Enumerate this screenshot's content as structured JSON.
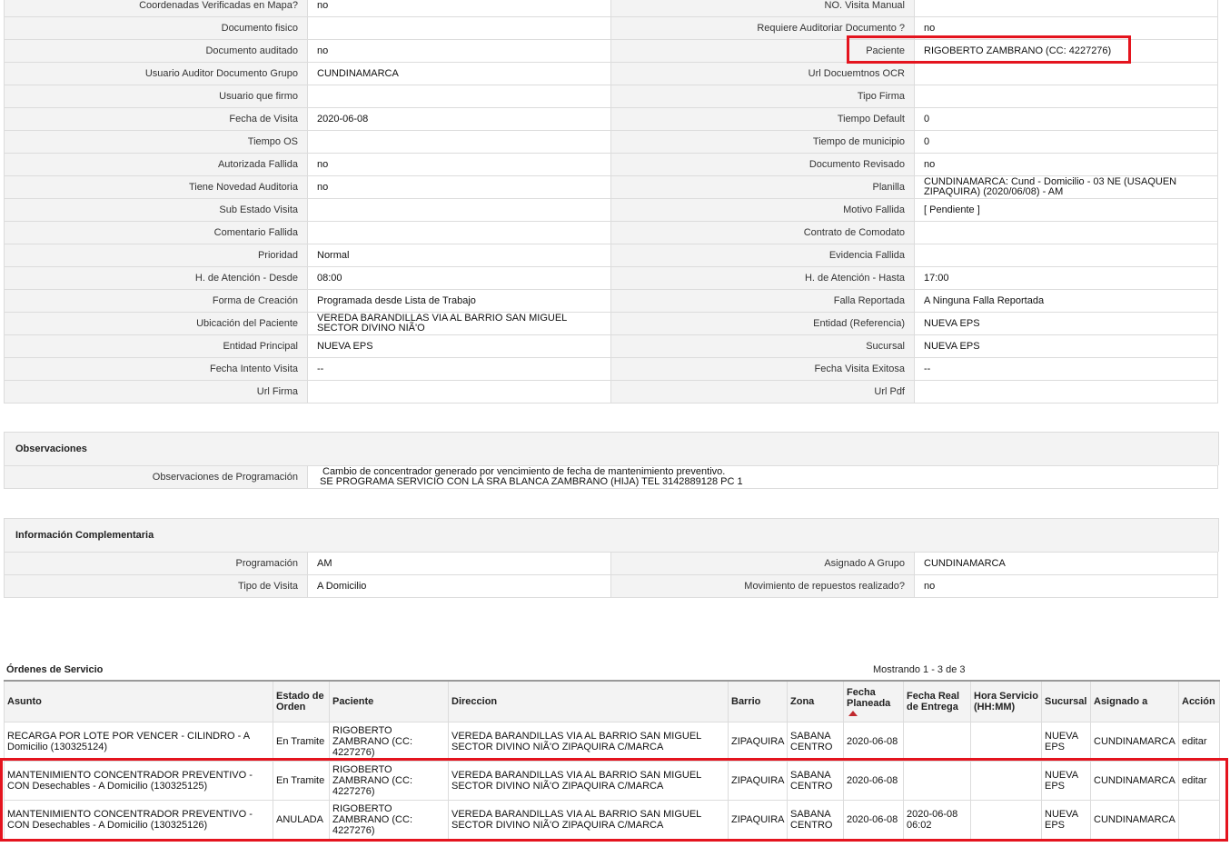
{
  "details": {
    "rows": [
      [
        {
          "label": "Coordenadas Verificadas en Mapa?",
          "value": "no"
        },
        {
          "label": "NO. Visita Manual",
          "value": ""
        }
      ],
      [
        {
          "label": "Documento fisico",
          "value": ""
        },
        {
          "label": "Requiere Auditoriar Documento ?",
          "value": "no"
        }
      ],
      [
        {
          "label": "Documento auditado",
          "value": "no"
        },
        {
          "label": "Paciente",
          "value": "RIGOBERTO ZAMBRANO (CC: 4227276)"
        }
      ],
      [
        {
          "label": "Usuario Auditor Documento Grupo",
          "value": "CUNDINAMARCA"
        },
        {
          "label": "Url Docuemtnos OCR",
          "value": ""
        }
      ],
      [
        {
          "label": "Usuario que firmo",
          "value": ""
        },
        {
          "label": "Tipo Firma",
          "value": ""
        }
      ],
      [
        {
          "label": "Fecha de Visita",
          "value": "2020-06-08"
        },
        {
          "label": "Tiempo Default",
          "value": "0"
        }
      ],
      [
        {
          "label": "Tiempo OS",
          "value": ""
        },
        {
          "label": "Tiempo de municipio",
          "value": "0"
        }
      ],
      [
        {
          "label": "Autorizada Fallida",
          "value": "no"
        },
        {
          "label": "Documento Revisado",
          "value": "no"
        }
      ],
      [
        {
          "label": "Tiene Novedad Auditoria",
          "value": "no"
        },
        {
          "label": "Planilla",
          "value": "CUNDINAMARCA: Cund - Domicilio - 03 NE (USAQUEN ZIPAQUIRA) (2020/06/08) - AM"
        }
      ],
      [
        {
          "label": "Sub Estado Visita",
          "value": ""
        },
        {
          "label": "Motivo Fallida",
          "value": "[ Pendiente ]"
        }
      ],
      [
        {
          "label": "Comentario Fallida",
          "value": ""
        },
        {
          "label": "Contrato de Comodato",
          "value": ""
        }
      ],
      [
        {
          "label": "Prioridad",
          "value": "Normal"
        },
        {
          "label": "Evidencia Fallida",
          "value": ""
        }
      ],
      [
        {
          "label": "H. de Atención - Desde",
          "value": "08:00"
        },
        {
          "label": "H. de Atención - Hasta",
          "value": "17:00"
        }
      ],
      [
        {
          "label": "Forma de Creación",
          "value": "Programada desde Lista de Trabajo"
        },
        {
          "label": "Falla Reportada",
          "value": "A Ninguna Falla Reportada"
        }
      ],
      [
        {
          "label": "Ubicación del Paciente",
          "value": "VEREDA BARANDILLAS VIA AL BARRIO SAN MIGUEL SECTOR DIVINO NIÃ'O"
        },
        {
          "label": "Entidad (Referencia)",
          "value": "NUEVA EPS"
        }
      ],
      [
        {
          "label": "Entidad Principal",
          "value": "NUEVA EPS"
        },
        {
          "label": "Sucursal",
          "value": "NUEVA EPS"
        }
      ],
      [
        {
          "label": "Fecha Intento Visita",
          "value": "--"
        },
        {
          "label": "Fecha Visita Exitosa",
          "value": "--"
        }
      ],
      [
        {
          "label": "Url Firma",
          "value": ""
        },
        {
          "label": "Url Pdf",
          "value": ""
        }
      ]
    ]
  },
  "observaciones": {
    "title": "Observaciones",
    "label": "Observaciones de Programación",
    "line1": "Cambio de concentrador generado por vencimiento de fecha de mantenimiento preventivo.",
    "line2": "SE PROGRAMA SERVICIO CON LA SRA BLANCA ZAMBRANO (HIJA) TEL 3142889128 PC 1"
  },
  "complementaria": {
    "title": "Información Complementaria",
    "rows": [
      [
        {
          "label": "Programación",
          "value": "AM"
        },
        {
          "label": "Asignado A Grupo",
          "value": "CUNDINAMARCA"
        }
      ],
      [
        {
          "label": "Tipo de Visita",
          "value": "A Domicilio"
        },
        {
          "label": "Movimiento de repuestos realizado?",
          "value": "no"
        }
      ]
    ]
  },
  "ordenes": {
    "title": "Órdenes de Servicio",
    "count": "Mostrando 1 - 3 de 3",
    "headers": [
      "Asunto",
      "Estado de Orden",
      "Paciente",
      "Direccion",
      "Barrio",
      "Zona",
      "Fecha Planeada",
      "Fecha Real de Entrega",
      "Hora Servicio (HH:MM)",
      "Sucursal",
      "Asignado a",
      "Acción"
    ],
    "sort_icon": "sort-asc-icon",
    "rows": [
      {
        "asunto": "RECARGA POR LOTE POR VENCER - CILINDRO - A Domicilio (130325124)",
        "estado": "En Tramite",
        "paciente": "RIGOBERTO ZAMBRANO (CC: 4227276)",
        "direccion": "VEREDA BARANDILLAS VIA AL BARRIO SAN MIGUEL SECTOR DIVINO NIÃ'O ZIPAQUIRA C/MARCA",
        "barrio": "ZIPAQUIRA",
        "zona": "SABANA CENTRO",
        "fecha_planeada": "2020-06-08",
        "fecha_real": "",
        "hora": "",
        "sucursal": "NUEVA EPS",
        "asignado": "CUNDINAMARCA",
        "accion": "editar"
      },
      {
        "asunto": "MANTENIMIENTO CONCENTRADOR PREVENTIVO - CON Desechables - A Domicilio (130325125)",
        "estado": "En Tramite",
        "paciente": "RIGOBERTO ZAMBRANO (CC: 4227276)",
        "direccion": "VEREDA BARANDILLAS VIA AL BARRIO SAN MIGUEL SECTOR DIVINO NIÃ'O ZIPAQUIRA C/MARCA",
        "barrio": "ZIPAQUIRA",
        "zona": "SABANA CENTRO",
        "fecha_planeada": "2020-06-08",
        "fecha_real": "",
        "hora": "",
        "sucursal": "NUEVA EPS",
        "asignado": "CUNDINAMARCA",
        "accion": "editar"
      },
      {
        "asunto": "MANTENIMIENTO CONCENTRADOR PREVENTIVO - CON Desechables - A Domicilio (130325126)",
        "estado": "ANULADA",
        "paciente": "RIGOBERTO ZAMBRANO (CC: 4227276)",
        "direccion": "VEREDA BARANDILLAS VIA AL BARRIO SAN MIGUEL SECTOR DIVINO NIÃ'O ZIPAQUIRA C/MARCA",
        "barrio": "ZIPAQUIRA",
        "zona": "SABANA CENTRO",
        "fecha_planeada": "2020-06-08",
        "fecha_real": "2020-06-08 06:02",
        "hora": "",
        "sucursal": "NUEVA EPS",
        "asignado": "CUNDINAMARCA",
        "accion": ""
      }
    ]
  },
  "colors": {
    "highlight": "#e4141e",
    "label_bg": "#f3f3f3",
    "border": "#dcdcdc"
  }
}
